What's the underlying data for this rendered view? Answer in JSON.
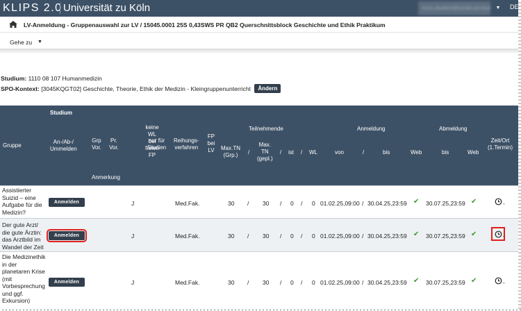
{
  "topbar": {
    "logo": "KLIPS 2.0",
    "university": "Universität zu Köln",
    "user_email": "kurs.student@smail.uni-koeln.de",
    "user_initials": "DE"
  },
  "breadcrumb": {
    "title": "LV-Anmeldung - Gruppenauswahl zur LV / 15045.0001 25S 0,43SWS PR QB2 Querschnittsblock Geschichte und Ethik Praktikum"
  },
  "nav": {
    "goto_label": "Gehe zu"
  },
  "study": {
    "label": "Studium:",
    "value": "1110 08 107 Humanmedizin",
    "spo_label": "SPO-Kontext:",
    "spo_value": "[3045KQGT02] Geschichte, Theorie, Ethik der Medizin - Kleingruppenunterricht",
    "change_button": "Ändern"
  },
  "table": {
    "headers": {
      "group": "Gruppe",
      "studium": "Studium",
      "register_action": "An-/Ab-/\nUmmelden",
      "annotation": "Anmerkung",
      "grp_vor": "Grp\nVor.",
      "pr_vor": "Pr.\nVor.",
      "no_wl": "keine\nWL\nbei\nfreien\nFP",
      "only_students": "nur für\nStudien",
      "ranking": "Reihungs-\nverfahren",
      "fp_lv": "FP\nbei\nLV",
      "participants": "Teilnehmende",
      "max_tn_grp": "Max.TN\n(Grp.)",
      "slash": "/",
      "max_tn_planned": "Max.\nTN\n(gepl.)",
      "ist": "ist",
      "wl": "WL",
      "registration": "Anmeldung",
      "from": "von",
      "to": "bis",
      "web": "Web",
      "deregistration": "Abmeldung",
      "time_place": "Zeit/Ort\n(1.Termin)"
    },
    "rows": [
      {
        "group": "Assistierter Suizid – eine Aufgabe für die Medizin?",
        "button": "Anmelden",
        "no_wl": "J",
        "ranking": "Med.Fak.",
        "max_grp": "30",
        "max_planned": "30",
        "ist": "0",
        "wl": "0",
        "reg_from": "01.02.25,09:00",
        "reg_to": "30.04.25,23:59",
        "dereg_to": "30.07.25,23:59",
        "time_place": "-"
      },
      {
        "group": "Der gute Arzt/ die gute Ärztin: das Arztbild im Wandel der Zeit",
        "button": "Anmelden",
        "no_wl": "J",
        "ranking": "Med.Fak.",
        "max_grp": "30",
        "max_planned": "30",
        "ist": "0",
        "wl": "0",
        "reg_from": "01.02.25,09:00",
        "reg_to": "30.04.25,23:59",
        "dereg_to": "30.07.25,23:59",
        "time_place": "-"
      },
      {
        "group": "Die Medizinethik in der planetaren Krise (mit Vorbesprechung und ggf. Exkursion)",
        "button": "Anmelden",
        "no_wl": "J",
        "ranking": "Med.Fak.",
        "max_grp": "30",
        "max_planned": "30",
        "ist": "0",
        "wl": "0",
        "reg_from": "01.02.25,09:00",
        "reg_to": "30.04.25,23:59",
        "dereg_to": "30.07.25,23:59",
        "time_place": "-"
      }
    ]
  },
  "colors": {
    "header_bg": "#3d5166",
    "button_bg": "#333f4d",
    "check_green": "#3a9a2a",
    "highlight_red": "#e0201e"
  },
  "icons": [
    "home-icon",
    "caret-down-icon",
    "check-icon",
    "clock-icon"
  ]
}
